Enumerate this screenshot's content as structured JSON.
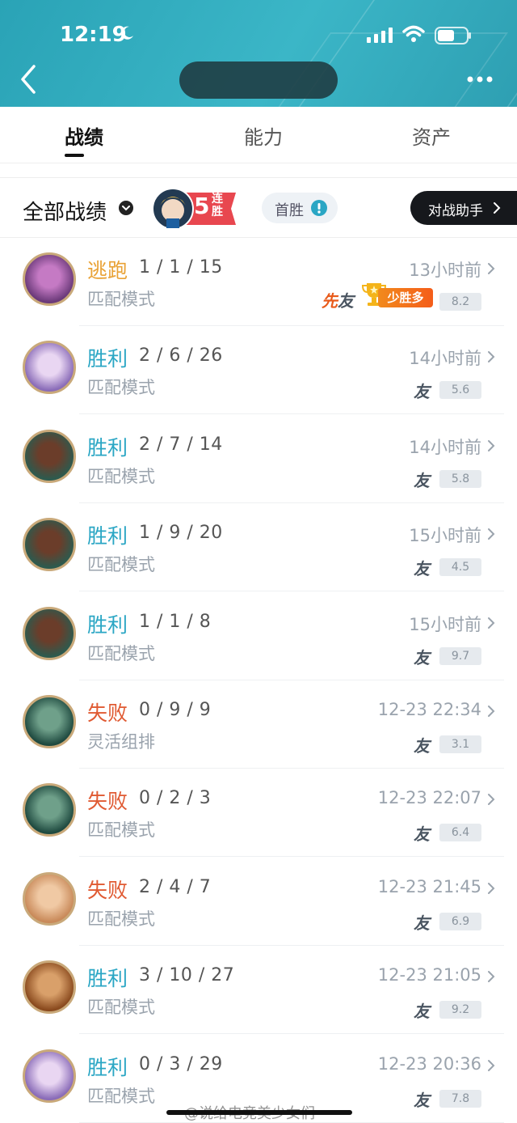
{
  "status_bar": {
    "time": "12:19"
  },
  "header": {
    "title": ""
  },
  "tabs": [
    {
      "label": "战绩",
      "active": true
    },
    {
      "label": "能力",
      "active": false
    },
    {
      "label": "资产",
      "active": false
    }
  ],
  "filter": {
    "label": "全部战绩",
    "streak_number": "5",
    "streak_text": "连胜",
    "first_win_label": "首胜",
    "assistant_label": "对战助手"
  },
  "matches": [
    {
      "result": "逃跑",
      "result_type": "flee",
      "kda": "1 / 1 / 15",
      "mode": "匹配模式",
      "time": "13小时前",
      "score": "8.2",
      "tags": {
        "first": "先",
        "friend": "友",
        "more_wins": "少胜多"
      }
    },
    {
      "result": "胜利",
      "result_type": "win",
      "kda": "2 / 6 / 26",
      "mode": "匹配模式",
      "time": "14小时前",
      "score": "5.6",
      "friend": "友"
    },
    {
      "result": "胜利",
      "result_type": "win",
      "kda": "2 / 7 / 14",
      "mode": "匹配模式",
      "time": "14小时前",
      "score": "5.8",
      "friend": "友"
    },
    {
      "result": "胜利",
      "result_type": "win",
      "kda": "1 / 9 / 20",
      "mode": "匹配模式",
      "time": "15小时前",
      "score": "4.5",
      "friend": "友"
    },
    {
      "result": "胜利",
      "result_type": "win",
      "kda": "1 / 1 / 8",
      "mode": "匹配模式",
      "time": "15小时前",
      "score": "9.7",
      "friend": "友"
    },
    {
      "result": "失败",
      "result_type": "lose",
      "kda": "0 / 9 / 9",
      "mode": "灵活组排",
      "time": "12-23 22:34",
      "score": "3.1",
      "friend": "友"
    },
    {
      "result": "失败",
      "result_type": "lose",
      "kda": "0 / 2 / 3",
      "mode": "匹配模式",
      "time": "12-23 22:07",
      "score": "6.4",
      "friend": "友"
    },
    {
      "result": "失败",
      "result_type": "lose",
      "kda": "2 / 4 / 7",
      "mode": "匹配模式",
      "time": "12-23 21:45",
      "score": "6.9",
      "friend": "友"
    },
    {
      "result": "胜利",
      "result_type": "win",
      "kda": "3 / 10 / 27",
      "mode": "匹配模式",
      "time": "12-23 21:05",
      "score": "9.2",
      "friend": "友"
    },
    {
      "result": "胜利",
      "result_type": "win",
      "kda": "0 / 3 / 29",
      "mode": "匹配模式",
      "time": "12-23 20:36",
      "score": "7.8",
      "friend": "友"
    }
  ],
  "watermark": "@说给电竞美少女们",
  "colors": {
    "accent": "#2aa6c4",
    "win": "#2aa6c4",
    "lose": "#e05a32",
    "flee": "#e9a236",
    "header": "#35adc0"
  }
}
